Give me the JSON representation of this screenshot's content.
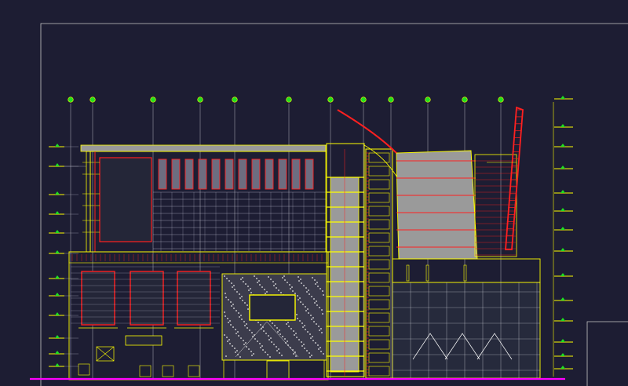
{
  "drawing": {
    "type": "architectural-elevation",
    "grid_bubble_count": 13,
    "level_marker_count_left": 12,
    "level_marker_count_right": 14,
    "colors": {
      "background": "#1d1d33",
      "frame": "#c8c8c8",
      "grid": "#ffffff",
      "primary": "#ffff00",
      "accent": "#ff2020",
      "ground": "#ff00ff",
      "panel_fill": "#9a9a9a",
      "dark_fill": "#242638",
      "green": "#20e020",
      "cyan": "#00e5ff"
    }
  }
}
